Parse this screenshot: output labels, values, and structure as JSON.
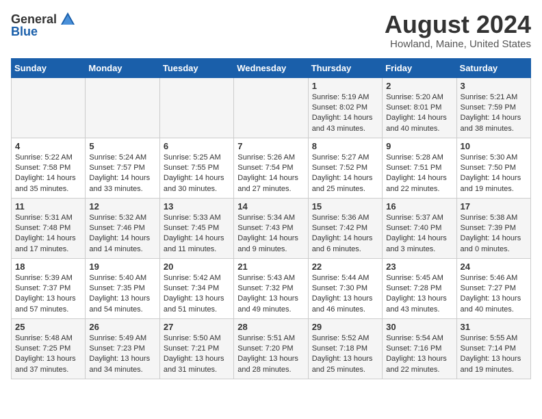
{
  "header": {
    "logo_general": "General",
    "logo_blue": "Blue",
    "title": "August 2024",
    "location": "Howland, Maine, United States"
  },
  "calendar": {
    "days_of_week": [
      "Sunday",
      "Monday",
      "Tuesday",
      "Wednesday",
      "Thursday",
      "Friday",
      "Saturday"
    ],
    "weeks": [
      [
        {
          "day": "",
          "info": ""
        },
        {
          "day": "",
          "info": ""
        },
        {
          "day": "",
          "info": ""
        },
        {
          "day": "",
          "info": ""
        },
        {
          "day": "1",
          "info": "Sunrise: 5:19 AM\nSunset: 8:02 PM\nDaylight: 14 hours\nand 43 minutes."
        },
        {
          "day": "2",
          "info": "Sunrise: 5:20 AM\nSunset: 8:01 PM\nDaylight: 14 hours\nand 40 minutes."
        },
        {
          "day": "3",
          "info": "Sunrise: 5:21 AM\nSunset: 7:59 PM\nDaylight: 14 hours\nand 38 minutes."
        }
      ],
      [
        {
          "day": "4",
          "info": "Sunrise: 5:22 AM\nSunset: 7:58 PM\nDaylight: 14 hours\nand 35 minutes."
        },
        {
          "day": "5",
          "info": "Sunrise: 5:24 AM\nSunset: 7:57 PM\nDaylight: 14 hours\nand 33 minutes."
        },
        {
          "day": "6",
          "info": "Sunrise: 5:25 AM\nSunset: 7:55 PM\nDaylight: 14 hours\nand 30 minutes."
        },
        {
          "day": "7",
          "info": "Sunrise: 5:26 AM\nSunset: 7:54 PM\nDaylight: 14 hours\nand 27 minutes."
        },
        {
          "day": "8",
          "info": "Sunrise: 5:27 AM\nSunset: 7:52 PM\nDaylight: 14 hours\nand 25 minutes."
        },
        {
          "day": "9",
          "info": "Sunrise: 5:28 AM\nSunset: 7:51 PM\nDaylight: 14 hours\nand 22 minutes."
        },
        {
          "day": "10",
          "info": "Sunrise: 5:30 AM\nSunset: 7:50 PM\nDaylight: 14 hours\nand 19 minutes."
        }
      ],
      [
        {
          "day": "11",
          "info": "Sunrise: 5:31 AM\nSunset: 7:48 PM\nDaylight: 14 hours\nand 17 minutes."
        },
        {
          "day": "12",
          "info": "Sunrise: 5:32 AM\nSunset: 7:46 PM\nDaylight: 14 hours\nand 14 minutes."
        },
        {
          "day": "13",
          "info": "Sunrise: 5:33 AM\nSunset: 7:45 PM\nDaylight: 14 hours\nand 11 minutes."
        },
        {
          "day": "14",
          "info": "Sunrise: 5:34 AM\nSunset: 7:43 PM\nDaylight: 14 hours\nand 9 minutes."
        },
        {
          "day": "15",
          "info": "Sunrise: 5:36 AM\nSunset: 7:42 PM\nDaylight: 14 hours\nand 6 minutes."
        },
        {
          "day": "16",
          "info": "Sunrise: 5:37 AM\nSunset: 7:40 PM\nDaylight: 14 hours\nand 3 minutes."
        },
        {
          "day": "17",
          "info": "Sunrise: 5:38 AM\nSunset: 7:39 PM\nDaylight: 14 hours\nand 0 minutes."
        }
      ],
      [
        {
          "day": "18",
          "info": "Sunrise: 5:39 AM\nSunset: 7:37 PM\nDaylight: 13 hours\nand 57 minutes."
        },
        {
          "day": "19",
          "info": "Sunrise: 5:40 AM\nSunset: 7:35 PM\nDaylight: 13 hours\nand 54 minutes."
        },
        {
          "day": "20",
          "info": "Sunrise: 5:42 AM\nSunset: 7:34 PM\nDaylight: 13 hours\nand 51 minutes."
        },
        {
          "day": "21",
          "info": "Sunrise: 5:43 AM\nSunset: 7:32 PM\nDaylight: 13 hours\nand 49 minutes."
        },
        {
          "day": "22",
          "info": "Sunrise: 5:44 AM\nSunset: 7:30 PM\nDaylight: 13 hours\nand 46 minutes."
        },
        {
          "day": "23",
          "info": "Sunrise: 5:45 AM\nSunset: 7:28 PM\nDaylight: 13 hours\nand 43 minutes."
        },
        {
          "day": "24",
          "info": "Sunrise: 5:46 AM\nSunset: 7:27 PM\nDaylight: 13 hours\nand 40 minutes."
        }
      ],
      [
        {
          "day": "25",
          "info": "Sunrise: 5:48 AM\nSunset: 7:25 PM\nDaylight: 13 hours\nand 37 minutes."
        },
        {
          "day": "26",
          "info": "Sunrise: 5:49 AM\nSunset: 7:23 PM\nDaylight: 13 hours\nand 34 minutes."
        },
        {
          "day": "27",
          "info": "Sunrise: 5:50 AM\nSunset: 7:21 PM\nDaylight: 13 hours\nand 31 minutes."
        },
        {
          "day": "28",
          "info": "Sunrise: 5:51 AM\nSunset: 7:20 PM\nDaylight: 13 hours\nand 28 minutes."
        },
        {
          "day": "29",
          "info": "Sunrise: 5:52 AM\nSunset: 7:18 PM\nDaylight: 13 hours\nand 25 minutes."
        },
        {
          "day": "30",
          "info": "Sunrise: 5:54 AM\nSunset: 7:16 PM\nDaylight: 13 hours\nand 22 minutes."
        },
        {
          "day": "31",
          "info": "Sunrise: 5:55 AM\nSunset: 7:14 PM\nDaylight: 13 hours\nand 19 minutes."
        }
      ]
    ]
  }
}
